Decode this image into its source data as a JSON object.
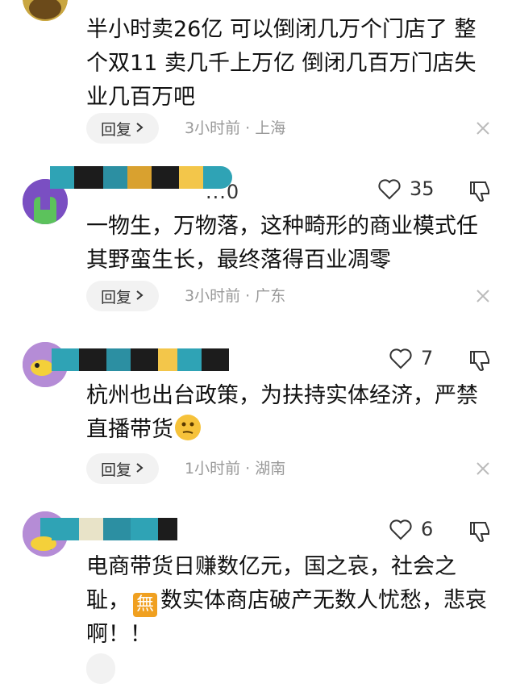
{
  "comments": [
    {
      "text": "半小时卖26亿 可以倒闭几万个门店了 整个双11 卖几千上万亿 倒闭几百万门店失业几百万吧",
      "reply_label": "回复",
      "meta": "3小时前 · 上海"
    },
    {
      "username": "...0",
      "likes": "35",
      "text": "一物生，万物落，这种畸形的商业模式任其野蛮生长，最终落得百业凋零",
      "reply_label": "回复",
      "meta": "3小时前 · 广东"
    },
    {
      "likes": "7",
      "text_before_emoji": "杭州也出台政策，为扶持实体经济，严禁直播带货",
      "reply_label": "回复",
      "meta": "1小时前 · 湖南"
    },
    {
      "likes": "6",
      "text_before_icon": "电商带货日赚数亿元，国之哀，社会之耻，",
      "gift_glyph": "無",
      "text_after_icon": "数实体商店破产无数人忧愁，悲哀啊！！"
    }
  ],
  "colors": {
    "reply_bg": "#f2f2f2",
    "meta_gray": "#999999",
    "avatar_green": "#3aa84a",
    "avatar_purple": "#b58cd6",
    "redaction": [
      "#2fa3b5",
      "#1c1c1c",
      "#d9a12f",
      "#2c8fa2",
      "#f3c64a",
      "#c44b2a"
    ]
  }
}
